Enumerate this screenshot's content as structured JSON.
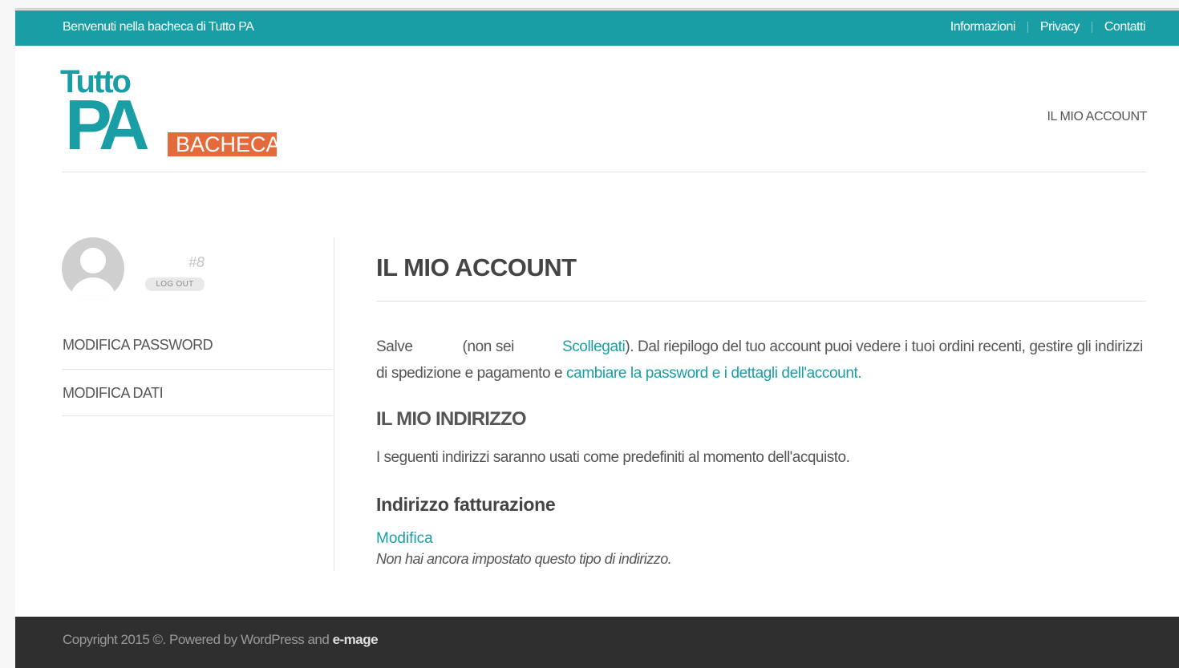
{
  "topbar": {
    "welcome": "Benvenuti nella bacheca di Tutto PA",
    "links": [
      "Informazioni",
      "Privacy",
      "Contatti"
    ]
  },
  "logo": {
    "tutto": "Tutto",
    "pa": "PA",
    "bacheca": "BACHECA"
  },
  "header": {
    "menu_item": "IL MIO ACCOUNT"
  },
  "sidebar": {
    "user_id": "#8",
    "logout": "LOG OUT",
    "items": [
      "MODIFICA PASSWORD",
      "MODIFICA DATI"
    ]
  },
  "content": {
    "title": "IL MIO ACCOUNT",
    "intro": {
      "salve": "Salve",
      "non_sei": "(non sei",
      "scollegati": "Scollegati",
      "after_scollegati": "). Dal riepilogo del tuo account puoi vedere i tuoi ordini recenti, gestire gli indirizzi di spedizione e pagamento e ",
      "change_link": "cambiare la password e i dettagli dell'account",
      "end": "."
    },
    "address_title": "IL MIO INDIRIZZO",
    "address_desc": "I seguenti indirizzi saranno usati come predefiniti al momento dell'acquisto.",
    "billing_title": "Indirizzo fatturazione",
    "edit_link": "Modifica",
    "no_address": "Non hai ancora impostato questo tipo di indirizzo."
  },
  "footer": {
    "copyright": "Copyright 2015 ©. Powered by WordPress and ",
    "brand": "e-mage"
  },
  "colors": {
    "accent": "#1a9ea6",
    "bacheca": "#e36b3b",
    "footer": "#2f2f2f"
  }
}
